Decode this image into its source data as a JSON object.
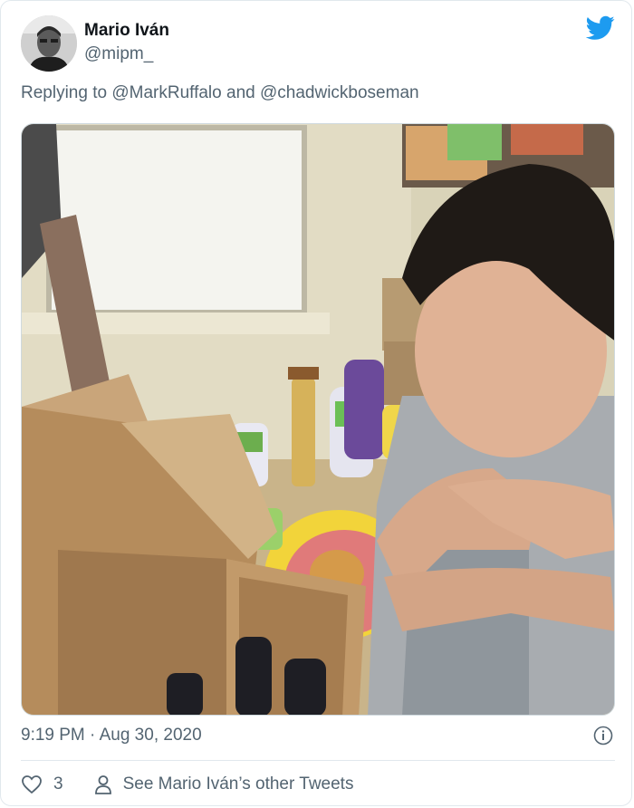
{
  "tweet": {
    "author_name": "Mario Iván",
    "author_handle": "@mipm_",
    "reply_prefix": "Replying to",
    "mention_1": "@MarkRuffalo",
    "reply_and": "and",
    "mention_2": "@chadwickboseman",
    "timestamp": "9:19 PM · Aug 30, 2020",
    "like_count": "3",
    "see_more_label": "See Mario Iván’s other Tweets"
  },
  "icons": {
    "logo": "twitter-bird-icon",
    "info": "info-icon",
    "like": "heart-icon",
    "profile": "person-icon"
  },
  "colors": {
    "brand": "#1d9bf0",
    "secondary_text": "#536471",
    "primary_text": "#0f1419"
  }
}
